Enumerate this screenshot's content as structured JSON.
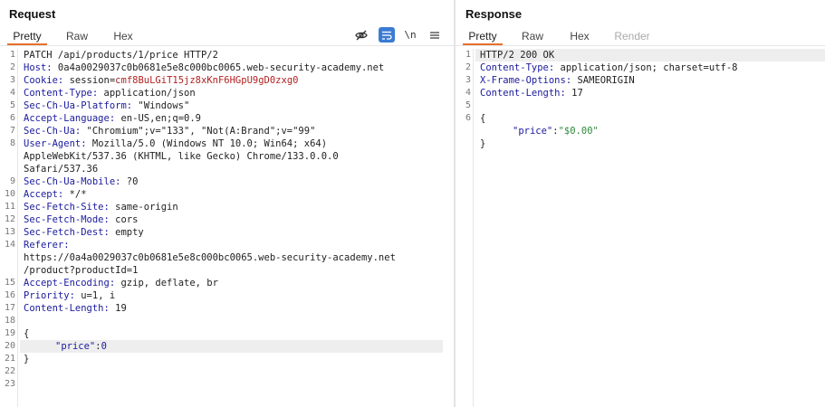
{
  "request": {
    "title": "Request",
    "tabs": [
      "Pretty",
      "Raw",
      "Hex"
    ],
    "icons": {
      "hide": "eye-slash-icon",
      "wrap": "wrap-lines-icon",
      "newline": "\\n",
      "menu": "hamburger-menu-icon"
    },
    "lines": {
      "l1": {
        "n": "1",
        "text": "PATCH /api/products/1/price HTTP/2"
      },
      "l2": {
        "n": "2",
        "key": "Host:",
        "val": " 0a4a0029037c0b0681e5e8c000bc0065.web-security-academy.net"
      },
      "l3": {
        "n": "3",
        "key": "Cookie:",
        "val": " session=",
        "cookie": "cmf8BuLGiT15jz8xKnF6HGpU9gD0zxg0"
      },
      "l4": {
        "n": "4",
        "key": "Content-Type:",
        "val": " application/json"
      },
      "l5": {
        "n": "5",
        "key": "Sec-Ch-Ua-Platform:",
        "val": " \"Windows\""
      },
      "l6": {
        "n": "6",
        "key": "Accept-Language:",
        "val": " en-US,en;q=0.9"
      },
      "l7": {
        "n": "7",
        "key": "Sec-Ch-Ua:",
        "val": " \"Chromium\";v=\"133\", \"Not(A:Brand\";v=\"99\""
      },
      "l8": {
        "n": "8",
        "key": "User-Agent:",
        "val": " Mozilla/5.0 (Windows NT 10.0; Win64; x64)"
      },
      "l8b": {
        "text": "AppleWebKit/537.36 (KHTML, like Gecko) Chrome/133.0.0.0"
      },
      "l8c": {
        "text": "Safari/537.36"
      },
      "l9": {
        "n": "9",
        "key": "Sec-Ch-Ua-Mobile:",
        "val": " ?0"
      },
      "l10": {
        "n": "10",
        "key": "Accept:",
        "val": " */*"
      },
      "l11": {
        "n": "11",
        "key": "Sec-Fetch-Site:",
        "val": " same-origin"
      },
      "l12": {
        "n": "12",
        "key": "Sec-Fetch-Mode:",
        "val": " cors"
      },
      "l13": {
        "n": "13",
        "key": "Sec-Fetch-Dest:",
        "val": " empty"
      },
      "l14": {
        "n": "14",
        "key": "Referer:",
        "val": ""
      },
      "l14b": {
        "text": "https://0a4a0029037c0b0681e5e8c000bc0065.web-security-academy.net"
      },
      "l14c": {
        "text": "/product?productId=1"
      },
      "l15": {
        "n": "15",
        "key": "Accept-Encoding:",
        "val": " gzip, deflate, br"
      },
      "l16": {
        "n": "16",
        "key": "Priority:",
        "val": " u=1, i"
      },
      "l17": {
        "n": "17",
        "key": "Content-Length:",
        "val": " 19"
      },
      "l18": {
        "n": "18"
      },
      "l19": {
        "n": "19",
        "text": "{"
      },
      "l20": {
        "n": "20",
        "jkey": "\"price\"",
        "colon": ":",
        "jval": "0"
      },
      "l21": {
        "n": "21",
        "text": "}"
      },
      "l22": {
        "n": "22"
      },
      "l23": {
        "n": "23"
      }
    }
  },
  "response": {
    "title": "Response",
    "tabs": [
      "Pretty",
      "Raw",
      "Hex",
      "Render"
    ],
    "lines": {
      "l1": {
        "n": "1",
        "text": "HTTP/2 200 OK"
      },
      "l2": {
        "n": "2",
        "key": "Content-Type:",
        "val": " application/json; charset=utf-8"
      },
      "l3": {
        "n": "3",
        "key": "X-Frame-Options:",
        "val": " SAMEORIGIN"
      },
      "l4": {
        "n": "4",
        "key": "Content-Length:",
        "val": " 17"
      },
      "l5": {
        "n": "5"
      },
      "l6": {
        "n": "6",
        "text": "{"
      },
      "l7": {
        "jkey": "\"price\"",
        "colon": ":",
        "jval": "\"$0.00\""
      },
      "l8": {
        "text": "}"
      }
    }
  },
  "colors": {
    "accent": "#e8702a",
    "wrap_active": "#3b7bd4",
    "header_key": "#1a1a9e",
    "cookie": "#b22222",
    "json_string": "#2e8b3a"
  }
}
